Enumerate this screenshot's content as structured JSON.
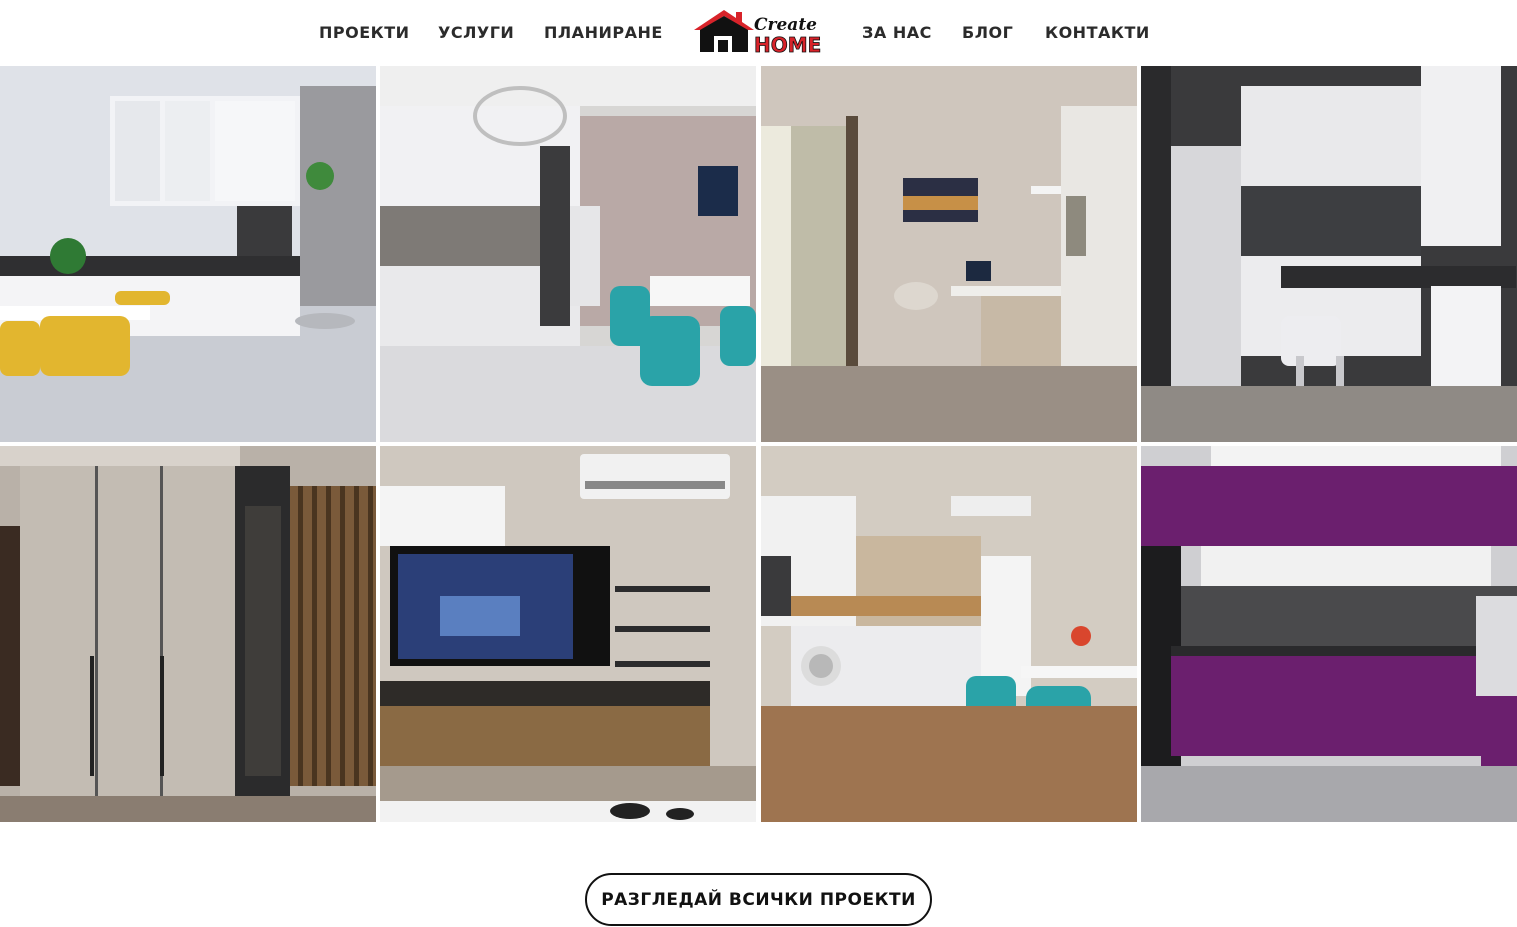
{
  "nav": {
    "left": [
      "ПРОЕКТИ",
      "УСЛУГИ",
      "ПЛАНИРАНЕ"
    ],
    "right": [
      "ЗА НАС",
      "БЛОГ",
      "КОНТАКТИ"
    ]
  },
  "logo": {
    "top_word": "Create",
    "bottom_word": "HOME"
  },
  "gallery": [
    {
      "subject": "white gloss kitchen with yellow chairs"
    },
    {
      "subject": "white kitchen with marble wall and teal chairs"
    },
    {
      "subject": "home office corner with shelving"
    },
    {
      "subject": "white and black kitchen with bar stool"
    },
    {
      "subject": "mirrored wardrobe hallway"
    },
    {
      "subject": "tv wall unit with wood cabinet"
    },
    {
      "subject": "small kitchen with teal chairs"
    },
    {
      "subject": "purple gloss kitchen"
    }
  ],
  "cta": {
    "label": "РАЗГЛЕДАЙ ВСИЧКИ ПРОЕКТИ"
  },
  "colors": {
    "logo_red": "#d8232a",
    "text": "#2b2b2b",
    "purple": "#6b1f6e",
    "teal": "#2aa3a8"
  }
}
